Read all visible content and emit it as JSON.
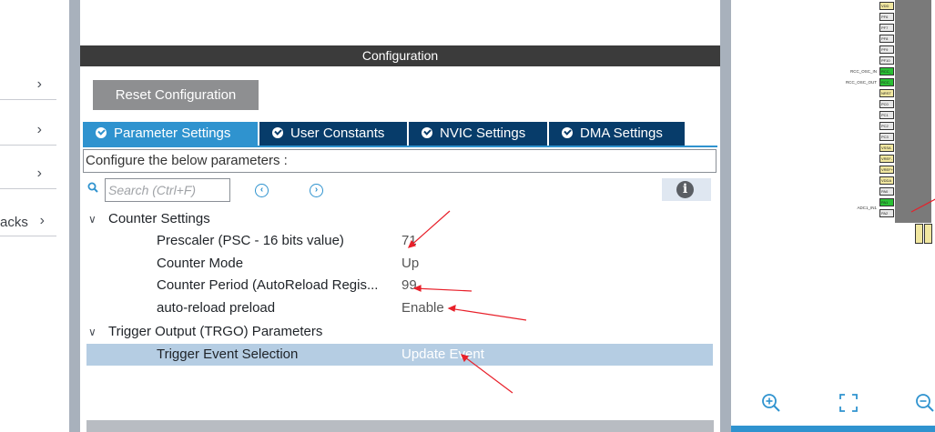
{
  "left_nav": {
    "items": [
      {
        "label": ""
      },
      {
        "label": ""
      },
      {
        "label": ""
      },
      {
        "label": "acks"
      }
    ]
  },
  "configuration": {
    "header": "Configuration",
    "reset_button": "Reset Configuration",
    "tabs": [
      {
        "label": "Parameter Settings",
        "active": true
      },
      {
        "label": "User Constants",
        "active": false
      },
      {
        "label": "NVIC Settings",
        "active": false
      },
      {
        "label": "DMA Settings",
        "active": false
      }
    ],
    "configure_label": "Configure the below parameters :",
    "search_placeholder": "Search (Ctrl+F)",
    "groups": [
      {
        "name": "Counter Settings",
        "params": [
          {
            "name": "Prescaler (PSC - 16 bits value)",
            "value": "71"
          },
          {
            "name": "Counter Mode",
            "value": "Up"
          },
          {
            "name": "Counter Period (AutoReload Regis...",
            "value": "99"
          },
          {
            "name": "auto-reload preload",
            "value": "Enable"
          }
        ]
      },
      {
        "name": "Trigger Output (TRGO) Parameters",
        "params": [
          {
            "name": "Trigger Event Selection",
            "value": "Update Event",
            "selected": true
          }
        ]
      }
    ]
  },
  "chip_view": {
    "pin_labels": [
      {
        "label": "RCC_OSC_IN"
      },
      {
        "label": "RCC_OSC_OUT"
      },
      {
        "label": "ADC1_IN1"
      }
    ],
    "pins": [
      "VDD",
      "PF6",
      "PF7",
      "PF8",
      "PF9",
      "PF10",
      "RCC_",
      "RCC_",
      "NRST",
      "PC0",
      "PC1",
      "PC2",
      "PC3",
      "VSSA",
      "VREF-",
      "VREF+",
      "VDDA",
      "PA0",
      "PA1",
      "PA2"
    ]
  },
  "colors": {
    "tab_active": "#2f93cf",
    "tab_inactive": "#073c6a",
    "header_bg": "#3b3b3b",
    "selected_row": "#b5cde3",
    "annotation": "#e8202a"
  }
}
